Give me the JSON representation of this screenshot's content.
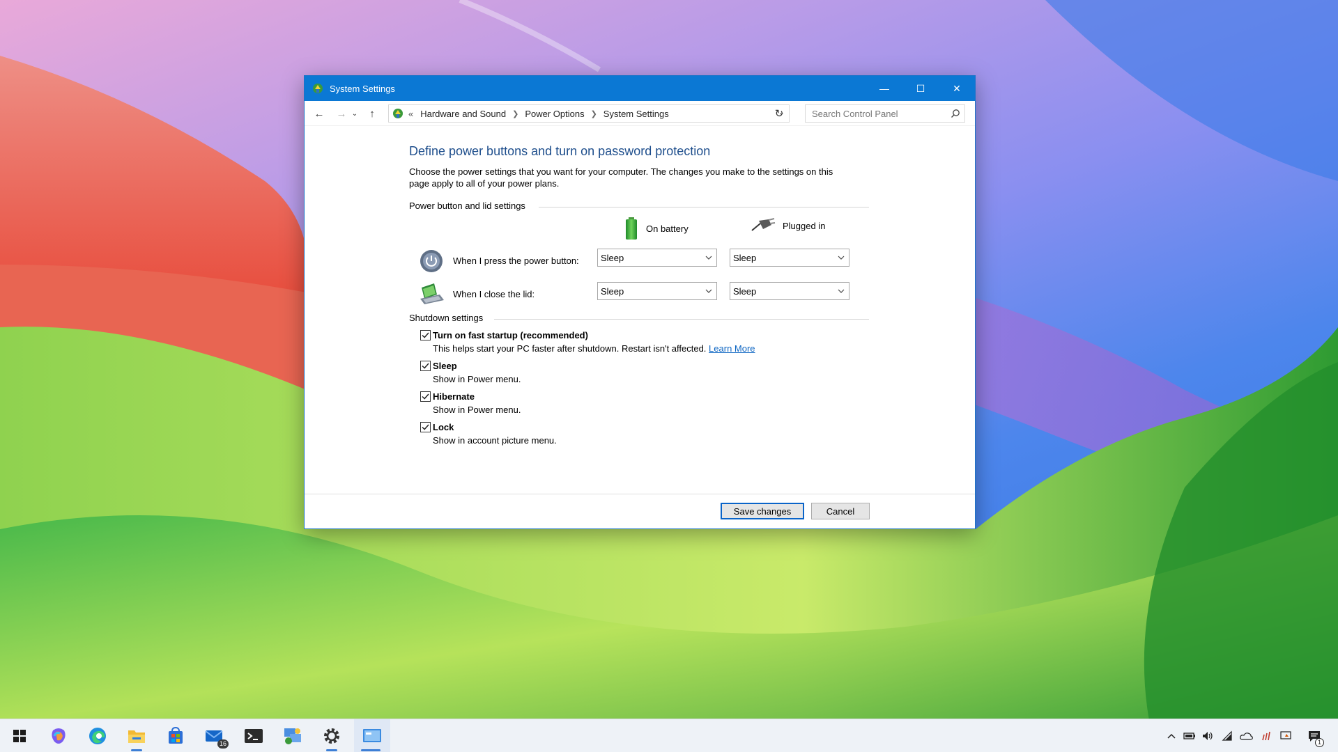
{
  "window": {
    "title": "System Settings",
    "controls": {
      "minimize": "—",
      "maximize": "☐",
      "close": "✕"
    }
  },
  "addressbar": {
    "overflow": "«",
    "breadcrumb": [
      "Hardware and Sound",
      "Power Options",
      "System Settings"
    ],
    "search_placeholder": "Search Control Panel"
  },
  "content": {
    "heading": "Define power buttons and turn on password protection",
    "description": "Choose the power settings that you want for your computer. The changes you make to the settings on this page apply to all of your power plans.",
    "power_group_title": "Power button and lid settings",
    "col_battery": "On battery",
    "col_plugged": "Plugged in",
    "rows": [
      {
        "label": "When I press the power button:",
        "battery": "Sleep",
        "plugged": "Sleep"
      },
      {
        "label": "When I close the lid:",
        "battery": "Sleep",
        "plugged": "Sleep"
      }
    ],
    "shutdown_group_title": "Shutdown settings",
    "checkboxes": [
      {
        "label": "Turn on fast startup (recommended)",
        "sub": "This helps start your PC faster after shutdown. Restart isn't affected.",
        "link": "Learn More",
        "checked": true
      },
      {
        "label": "Sleep",
        "sub": "Show in Power menu.",
        "checked": true
      },
      {
        "label": "Hibernate",
        "sub": "Show in Power menu.",
        "checked": true
      },
      {
        "label": "Lock",
        "sub": "Show in account picture menu.",
        "checked": true
      }
    ]
  },
  "footer": {
    "save": "Save changes",
    "cancel": "Cancel"
  },
  "taskbar": {
    "mail_badge": "16",
    "notification_count": "1",
    "icons": [
      "start-icon",
      "copilot-icon",
      "edge-icon",
      "file-explorer-icon",
      "store-icon",
      "mail-icon",
      "terminal-icon",
      "control-panel-icon",
      "settings-icon",
      "system-settings-icon"
    ],
    "tray_icons": [
      "chevron-up-icon",
      "battery-icon",
      "volume-icon",
      "wifi-icon",
      "onedrive-icon",
      "pen-icon",
      "display-icon",
      "notification-icon"
    ]
  },
  "colors": {
    "titlebar": "#0b78d4",
    "heading": "#1e4e8c",
    "link": "#0b64c2",
    "primary_button_border": "#0a64c9"
  }
}
